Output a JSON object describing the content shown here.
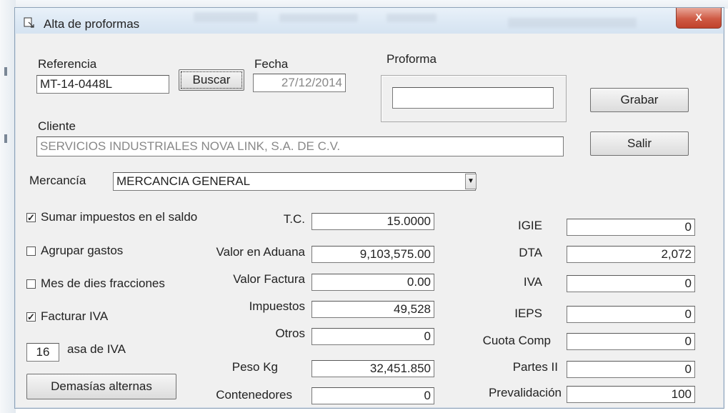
{
  "window": {
    "title": "Alta de proformas",
    "close_label": "X"
  },
  "fields": {
    "referencia": {
      "label": "Referencia",
      "value": "MT-14-0448L"
    },
    "buscar_label": "Buscar",
    "fecha": {
      "label": "Fecha",
      "value": "27/12/2014"
    },
    "proforma": {
      "label": "Proforma",
      "value": ""
    },
    "grabar_label": "Grabar",
    "salir_label": "Salir",
    "cliente": {
      "label": "Cliente",
      "value": "SERVICIOS INDUSTRIALES NOVA LINK, S.A. DE C.V."
    },
    "mercancia": {
      "label": "Mercancía",
      "value": "MERCANCIA GENERAL"
    }
  },
  "options": [
    {
      "label": "Sumar impuestos en el saldo",
      "checked": true
    },
    {
      "label": "Agrupar gastos",
      "checked": false
    },
    {
      "label": "Mes de dies fracciones",
      "checked": false
    },
    {
      "label": "Facturar IVA",
      "checked": true
    }
  ],
  "tasa_iva": {
    "label": "asa de IVA",
    "value": "16"
  },
  "demas_button_label": "Demasías alternas",
  "middle": [
    {
      "label": "T.C.",
      "value": "15.0000"
    },
    {
      "label": "Valor en Aduana",
      "value": "9,103,575.00"
    },
    {
      "label": "Valor Factura",
      "value": "0.00"
    },
    {
      "label": "Impuestos",
      "value": "49,528"
    },
    {
      "label": "Otros",
      "value": "0"
    },
    {
      "label": "Peso Kg",
      "value": "32,451.850"
    },
    {
      "label": "Contenedores",
      "value": "0"
    }
  ],
  "right": [
    {
      "label": "IGIE",
      "value": "0"
    },
    {
      "label": "DTA",
      "value": "2,072"
    },
    {
      "label": "IVA",
      "value": "0"
    },
    {
      "label": "IEPS",
      "value": "0"
    },
    {
      "label": "Cuota Comp",
      "value": "0"
    },
    {
      "label": "Partes II",
      "value": "0"
    },
    {
      "label": "Prevalidación",
      "value": "100"
    }
  ],
  "colors": {
    "titlebar": "#dce8f4",
    "close": "#c9523c",
    "form_bg": "#f0f0f0"
  }
}
